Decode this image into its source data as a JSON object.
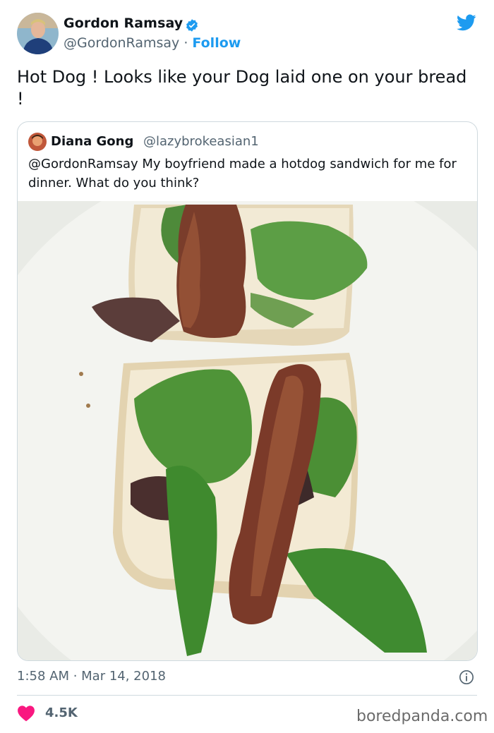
{
  "tweet": {
    "author_name": "Gordon Ramsay",
    "author_handle": "@GordonRamsay",
    "separator": "·",
    "follow_label": "Follow",
    "text": "Hot Dog ! Looks like your Dog laid one on your bread !",
    "timestamp": "1:58 AM · Mar 14, 2018",
    "like_count": "4.5K"
  },
  "quoted_tweet": {
    "author_name": "Diana Gong",
    "author_handle": "@lazybrokeasian1",
    "text": "@GordonRamsay My boyfriend made a hotdog sandwich for me for dinner. What do you think?"
  },
  "watermark": "boredpanda.com",
  "icons": {
    "verified": "verified-badge-icon",
    "brand": "twitter-bird-icon",
    "info": "info-icon",
    "like": "heart-icon"
  },
  "colors": {
    "accent": "#1d9bf0",
    "heart": "#f91880",
    "secondary_text": "#536471",
    "border": "#cfd9de"
  }
}
